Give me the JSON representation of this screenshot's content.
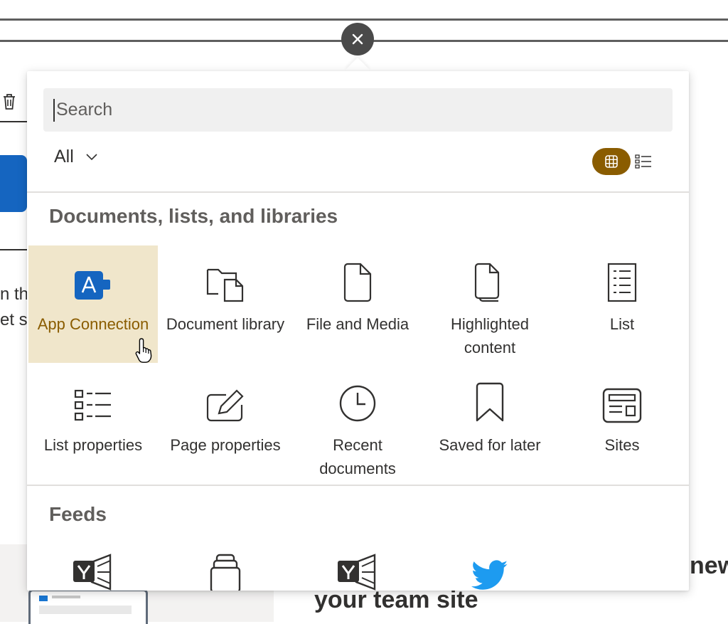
{
  "background": {
    "text_line1": "n th",
    "text_line2": "et s",
    "heading": "your team site",
    "heading_right": "new"
  },
  "picker": {
    "close_label": "×",
    "search": {
      "placeholder": "Search",
      "value": ""
    },
    "filter": {
      "selected": "All"
    },
    "view": {
      "active": "grid"
    },
    "sections": [
      {
        "title": "Documents, lists, and libraries",
        "tiles": [
          {
            "label": "App Connection",
            "icon": "app-connection-icon",
            "selected": true
          },
          {
            "label": "Document library",
            "icon": "document-library-icon"
          },
          {
            "label": "File and Media",
            "icon": "file-icon"
          },
          {
            "label": "Highlighted content",
            "icon": "highlighted-content-icon"
          },
          {
            "label": "List",
            "icon": "list-icon"
          },
          {
            "label": "List properties",
            "icon": "list-properties-icon"
          },
          {
            "label": "Page properties",
            "icon": "page-properties-icon"
          },
          {
            "label": "Recent documents",
            "icon": "clock-icon"
          },
          {
            "label": "Saved for later",
            "icon": "bookmark-icon"
          },
          {
            "label": "Sites",
            "icon": "sites-icon"
          }
        ]
      },
      {
        "title": "Feeds",
        "tiles": [
          {
            "label": "",
            "icon": "yammer-icon"
          },
          {
            "label": "",
            "icon": "news-stack-icon"
          },
          {
            "label": "",
            "icon": "yammer-icon"
          },
          {
            "label": "",
            "icon": "twitter-icon"
          }
        ]
      }
    ]
  },
  "colors": {
    "accent": "#8a5c00",
    "selected_bg": "#f0e6cb",
    "app_icon_blue": "#1565c0",
    "twitter_blue": "#1d9bf0"
  }
}
